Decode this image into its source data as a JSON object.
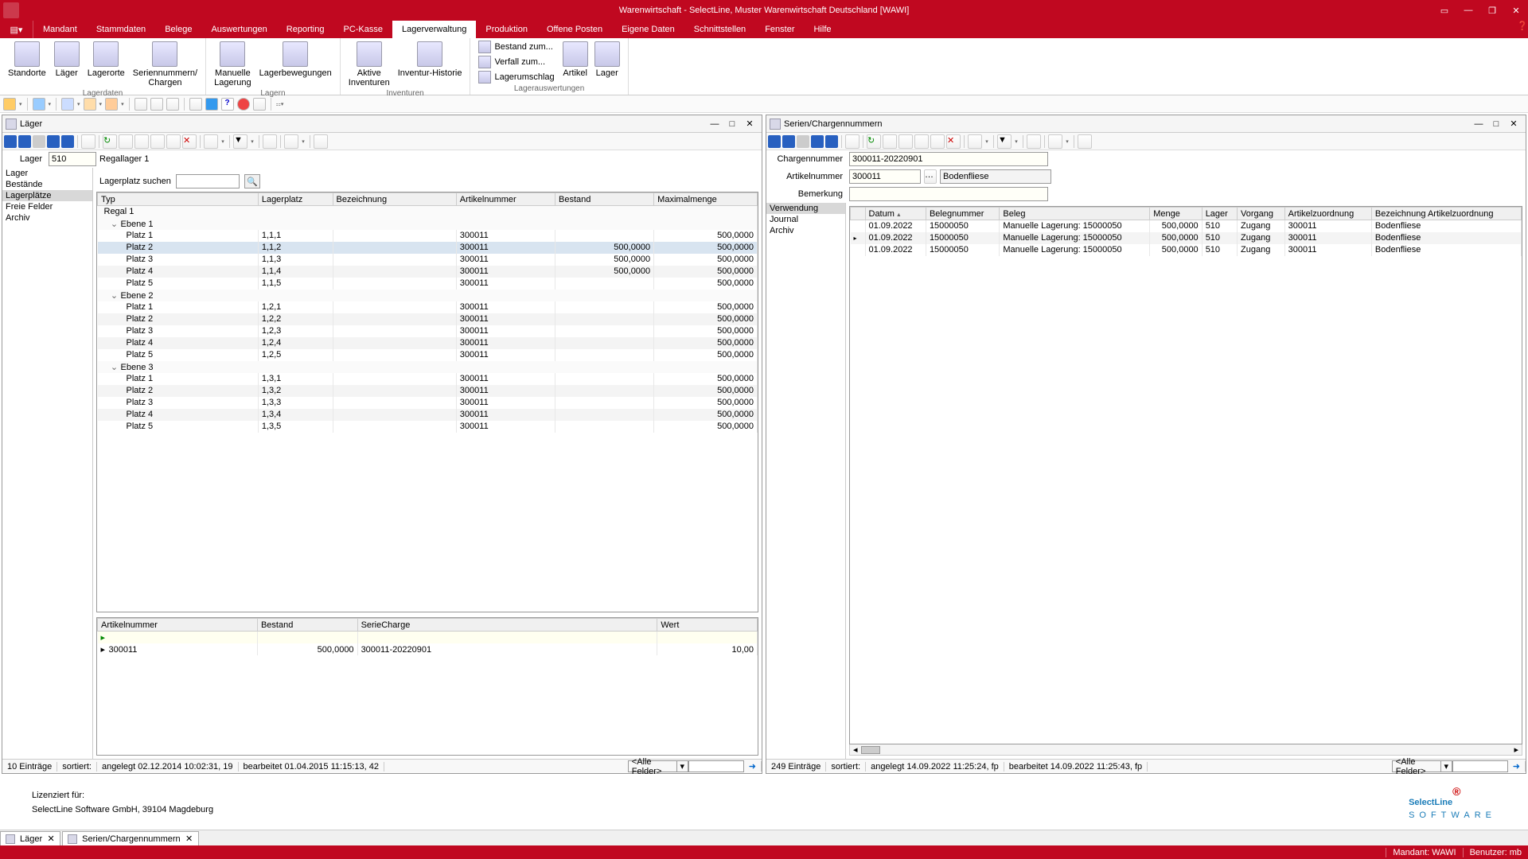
{
  "title": "Warenwirtschaft - SelectLine, Muster Warenwirtschaft Deutschland [WAWI]",
  "menu": {
    "items": [
      "Mandant",
      "Stammdaten",
      "Belege",
      "Auswertungen",
      "Reporting",
      "PC-Kasse",
      "Lagerverwaltung",
      "Produktion",
      "Offene Posten",
      "Eigene Daten",
      "Schnittstellen",
      "Fenster",
      "Hilfe"
    ],
    "active": 6
  },
  "ribbon": {
    "g1": {
      "name": "Lagerdaten",
      "btns": [
        "Standorte",
        "Läger",
        "Lagerorte",
        "Seriennummern/\nChargen"
      ]
    },
    "g2": {
      "name": "Lagern",
      "btns": [
        "Manuelle\nLagerung",
        "Lagerbewegungen"
      ]
    },
    "g3": {
      "name": "Inventuren",
      "btns": [
        "Aktive\nInventuren",
        "Inventur-Historie"
      ]
    },
    "g4": {
      "name": "Lagerauswertungen",
      "small": [
        "Bestand zum...",
        "Verfall zum...",
        "Lagerumschlag"
      ],
      "btns": [
        "Artikel",
        "Lager"
      ]
    }
  },
  "left": {
    "title": "Läger",
    "lager_lbl": "Lager",
    "lager_val": "510",
    "lager_desc": "Regallager 1",
    "nav": [
      "Lager",
      "Bestände",
      "Lagerplätze",
      "Freie Felder",
      "Archiv"
    ],
    "nav_sel": 2,
    "search_lbl": "Lagerplatz suchen",
    "cols": [
      "Typ",
      "Lagerplatz",
      "Bezeichnung",
      "Artikelnummer",
      "Bestand",
      "Maximalmenge"
    ],
    "tree": [
      {
        "t": "root",
        "lbl": "Regal 1"
      },
      {
        "t": "grp",
        "lbl": "Ebene 1"
      },
      {
        "t": "r",
        "c": [
          "Platz 1",
          "1,1,1",
          "",
          "300011",
          "",
          "500,0000"
        ]
      },
      {
        "t": "r",
        "sel": true,
        "c": [
          "Platz 2",
          "1,1,2",
          "",
          "300011",
          "500,0000",
          "500,0000"
        ]
      },
      {
        "t": "r",
        "c": [
          "Platz 3",
          "1,1,3",
          "",
          "300011",
          "500,0000",
          "500,0000"
        ]
      },
      {
        "t": "r",
        "c": [
          "Platz 4",
          "1,1,4",
          "",
          "300011",
          "500,0000",
          "500,0000"
        ]
      },
      {
        "t": "r",
        "c": [
          "Platz 5",
          "1,1,5",
          "",
          "300011",
          "",
          "500,0000"
        ]
      },
      {
        "t": "grp",
        "lbl": "Ebene 2"
      },
      {
        "t": "r",
        "c": [
          "Platz 1",
          "1,2,1",
          "",
          "300011",
          "",
          "500,0000"
        ]
      },
      {
        "t": "r",
        "c": [
          "Platz 2",
          "1,2,2",
          "",
          "300011",
          "",
          "500,0000"
        ]
      },
      {
        "t": "r",
        "c": [
          "Platz 3",
          "1,2,3",
          "",
          "300011",
          "",
          "500,0000"
        ]
      },
      {
        "t": "r",
        "c": [
          "Platz 4",
          "1,2,4",
          "",
          "300011",
          "",
          "500,0000"
        ]
      },
      {
        "t": "r",
        "c": [
          "Platz 5",
          "1,2,5",
          "",
          "300011",
          "",
          "500,0000"
        ]
      },
      {
        "t": "grp",
        "lbl": "Ebene 3"
      },
      {
        "t": "r",
        "c": [
          "Platz 1",
          "1,3,1",
          "",
          "300011",
          "",
          "500,0000"
        ]
      },
      {
        "t": "r",
        "c": [
          "Platz 2",
          "1,3,2",
          "",
          "300011",
          "",
          "500,0000"
        ]
      },
      {
        "t": "r",
        "c": [
          "Platz 3",
          "1,3,3",
          "",
          "300011",
          "",
          "500,0000"
        ]
      },
      {
        "t": "r",
        "c": [
          "Platz 4",
          "1,3,4",
          "",
          "300011",
          "",
          "500,0000"
        ]
      },
      {
        "t": "r",
        "c": [
          "Platz 5",
          "1,3,5",
          "",
          "300011",
          "",
          "500,0000"
        ]
      }
    ],
    "sub_cols": [
      "Artikelnummer",
      "Bestand",
      "SerieCharge",
      "Wert"
    ],
    "sub_rows": [
      [
        "300011",
        "500,0000",
        "300011-20220901",
        "10,00"
      ]
    ],
    "status": {
      "cnt": "10 Einträge",
      "sort": "sortiert:",
      "ang": "angelegt 02.12.2014 10:02:31, 19",
      "bea": "bearbeitet 01.04.2015 11:15:13, 42",
      "filter": "<Alle Felder>"
    }
  },
  "right": {
    "title": "Serien/Chargennummern",
    "f1_lbl": "Chargennummer",
    "f1_val": "300011-20220901",
    "f2_lbl": "Artikelnummer",
    "f2_val": "300011",
    "f2_desc": "Bodenfliese",
    "f3_lbl": "Bemerkung",
    "f3_val": "",
    "nav": [
      "Verwendung",
      "Journal",
      "Archiv"
    ],
    "nav_sel": 0,
    "cols": [
      "Datum",
      "Belegnummer",
      "Beleg",
      "Menge",
      "Lager",
      "Vorgang",
      "Artikelzuordnung",
      "Bezeichnung Artikelzuordnung"
    ],
    "rows": [
      {
        "c": [
          "01.09.2022",
          "15000050",
          "Manuelle Lagerung: 15000050",
          "500,0000",
          "510",
          "Zugang",
          "300011",
          "Bodenfliese"
        ]
      },
      {
        "cur": true,
        "c": [
          "01.09.2022",
          "15000050",
          "Manuelle Lagerung: 15000050",
          "500,0000",
          "510",
          "Zugang",
          "300011",
          "Bodenfliese"
        ]
      },
      {
        "c": [
          "01.09.2022",
          "15000050",
          "Manuelle Lagerung: 15000050",
          "500,0000",
          "510",
          "Zugang",
          "300011",
          "Bodenfliese"
        ]
      }
    ],
    "status": {
      "cnt": "249 Einträge",
      "sort": "sortiert:",
      "ang": "angelegt 14.09.2022 11:25:24, fp",
      "bea": "bearbeitet 14.09.2022 11:25:43, fp",
      "filter": "<Alle Felder>"
    }
  },
  "footer": {
    "lic_lbl": "Lizenziert für:",
    "lic_txt": "SelectLine Software GmbH, 39104 Magdeburg"
  },
  "tabs": [
    "Läger",
    "Serien/Chargennummern"
  ],
  "bottom": {
    "mandant": "Mandant: WAWI",
    "user": "Benutzer: mb"
  }
}
